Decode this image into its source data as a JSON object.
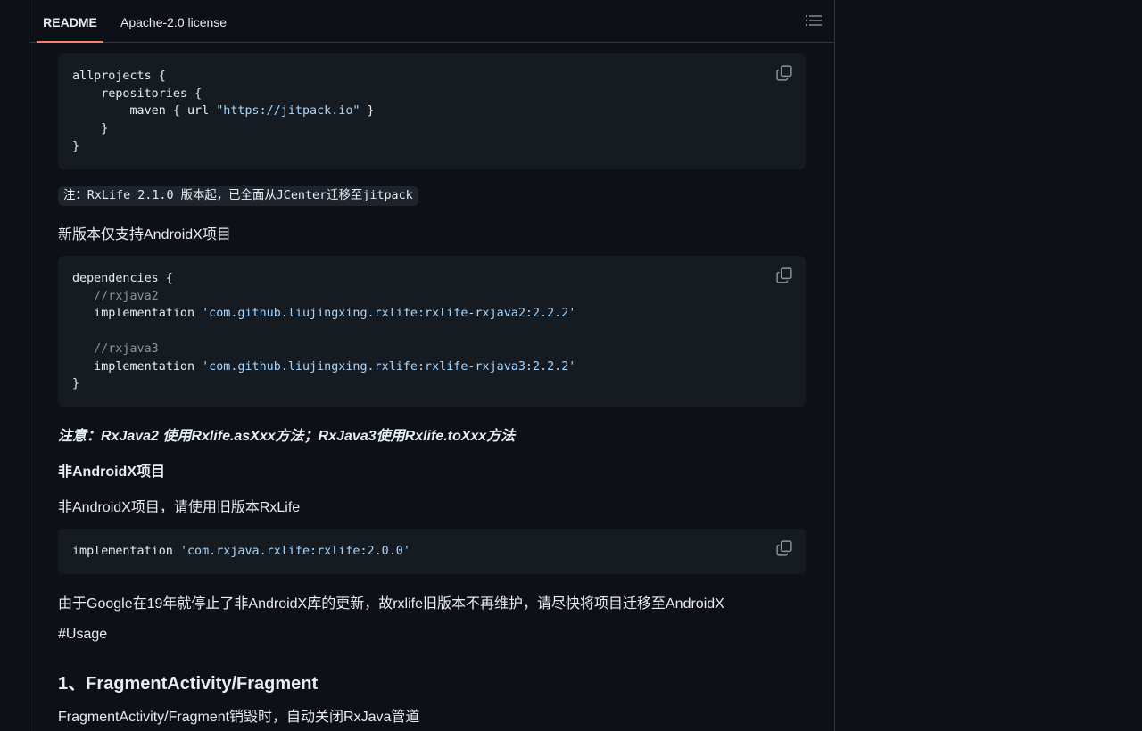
{
  "tabs": {
    "readme": "README",
    "license": "Apache-2.0 license"
  },
  "icons": {
    "toc": "list-unordered-icon",
    "copy": "copy-icon"
  },
  "colors": {
    "accent": "#f78166",
    "string": "#a5d6ff",
    "comment": "#8b949e",
    "background": "#0d1117",
    "code_bg": "#161b22"
  },
  "code1": {
    "l1": "allprojects {",
    "l2": "    repositories {",
    "l3_pre": "        maven { url ",
    "l3_str": "\"https://jitpack.io\"",
    "l3_post": " }",
    "l4": "    }",
    "l5": "}"
  },
  "note_inline": "注：RxLife 2.1.0 版本起，已全面从JCenter迁移至jitpack",
  "para_androidx_only": "新版本仅支持AndroidX项目",
  "code2": {
    "l1": "dependencies {",
    "l2_comment": "   //rxjava2",
    "l3_pre": "   implementation ",
    "l3_str": "'com.github.liujingxing.rxlife:rxlife-rxjava2:2.2.2'",
    "l5_comment": "   //rxjava3",
    "l6_pre": "   implementation ",
    "l6_str": "'com.github.liujingxing.rxlife:rxlife-rxjava3:2.2.2'",
    "l7": "}"
  },
  "attention": "注意：RxJava2 使用Rxlife.asXxx方法；RxJava3使用Rxlife.toXxx方法",
  "heading_non_androidx": "非AndroidX项目",
  "para_non_androidx": "非AndroidX项目，请使用旧版本RxLife",
  "code3": {
    "l1_pre": "implementation ",
    "l1_str": "'com.rxjava.rxlife:rxlife:2.0.0'"
  },
  "para_google": "由于Google在19年就停止了非AndroidX库的更新，故rxlife旧版本不再维护，请尽快将项目迁移至AndroidX",
  "usage": "#Usage",
  "heading_fragment": "1、FragmentActivity/Fragment",
  "para_fragment": "FragmentActivity/Fragment销毁时，自动关闭RxJava管道"
}
